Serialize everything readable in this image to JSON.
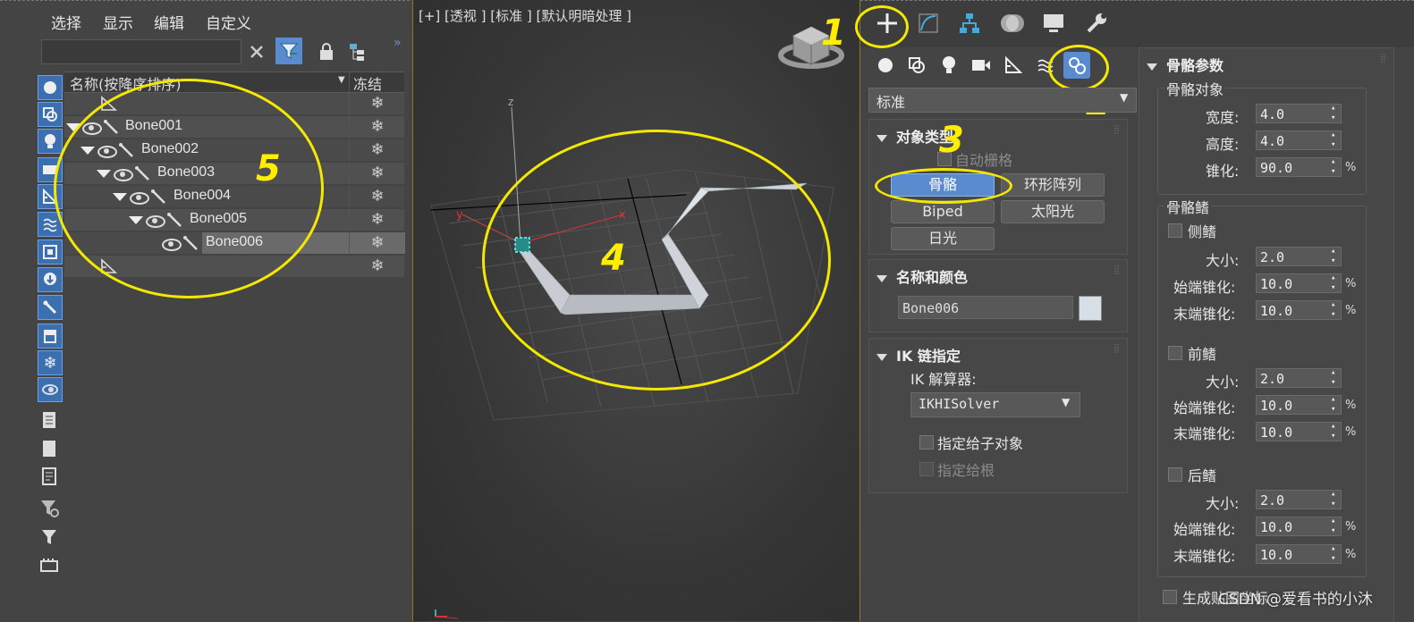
{
  "explorer": {
    "menu": [
      "选择",
      "显示",
      "编辑",
      "自定义"
    ],
    "search_value": "",
    "col_name": "名称(按降序排序)",
    "col_freeze": "冻结",
    "bones": [
      "Bone001",
      "Bone002",
      "Bone003",
      "Bone004",
      "Bone005",
      "Bone006"
    ],
    "freeze_glyph": "❄"
  },
  "viewport": {
    "label": "[+] [透视 ] [标准 ] [默认明暗处理 ]",
    "axis_x": "x",
    "axis_y": "y",
    "axis_z": "z"
  },
  "command_panel": {
    "tabs": [
      "create",
      "modify",
      "hierarchy",
      "motion",
      "display",
      "utilities"
    ],
    "categories": [
      "geometry",
      "shapes",
      "lights",
      "cameras",
      "helpers",
      "space-warps",
      "systems"
    ],
    "dropdown_value": "标准",
    "object_type": {
      "title": "对象类型",
      "auto_grid": "自动栅格",
      "buttons": [
        "骨骼",
        "环形阵列",
        "Biped",
        "太阳光",
        "日光"
      ]
    },
    "name_color": {
      "title": "名称和颜色",
      "name_value": "Bone006",
      "swatch_color": "#d8dee6"
    },
    "ik": {
      "title": "IK 链指定",
      "solver_label": "IK 解算器:",
      "solver_value": "IKHISolver",
      "assign_children": "指定给子对象",
      "assign_root": "指定给根"
    },
    "bone_params": {
      "title": "骨骼参数",
      "bone_object": "骨骼对象",
      "width_label": "宽度:",
      "width_value": "4.0",
      "height_label": "高度:",
      "height_value": "4.0",
      "taper_label": "锥化:",
      "taper_value": "90.0",
      "fins": "骨骼鳍",
      "side_fins": "侧鳍",
      "front_fin": "前鳍",
      "back_fin": "后鳍",
      "size_label": "大小:",
      "start_taper_label": "始端锥化:",
      "end_taper_label": "末端锥化:",
      "side_size": "2.0",
      "side_start": "10.0",
      "side_end": "10.0",
      "front_size": "2.0",
      "front_start": "10.0",
      "front_end": "10.0",
      "back_size": "2.0",
      "back_start": "10.0",
      "back_end": "10.0",
      "pct": "%",
      "gen_map": "生成贴图坐标"
    }
  },
  "annotations": [
    "1",
    "2",
    "3",
    "4",
    "5"
  ],
  "watermark": "CSDN @爱看书的小沐",
  "colors": {
    "annotation": "#f5e800",
    "accent": "#5b8bcf"
  }
}
